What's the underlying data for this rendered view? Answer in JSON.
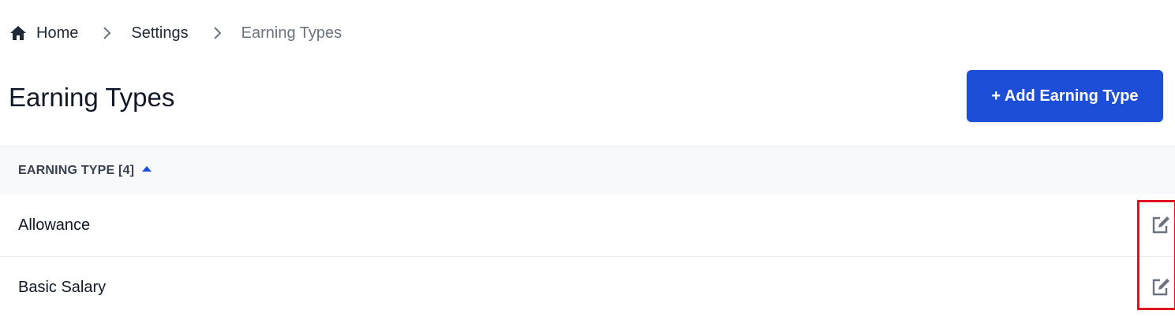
{
  "breadcrumb": {
    "items": [
      {
        "label": "Home",
        "icon": "home-icon"
      },
      {
        "label": "Settings"
      },
      {
        "label": "Earning Types"
      }
    ],
    "separator_icon": "chevron-right-icon"
  },
  "page": {
    "title": "Earning Types",
    "add_button_label": "+ Add Earning Type",
    "accent_color": "#1d4ed8"
  },
  "table": {
    "header_label": "EARNING TYPE [4]",
    "sort_icon": "caret-up-icon",
    "rows": [
      {
        "label": "Allowance",
        "action_icon": "edit-icon"
      },
      {
        "label": "Basic Salary",
        "action_icon": "edit-icon"
      }
    ]
  },
  "highlight": {
    "color": "#e0101e"
  }
}
